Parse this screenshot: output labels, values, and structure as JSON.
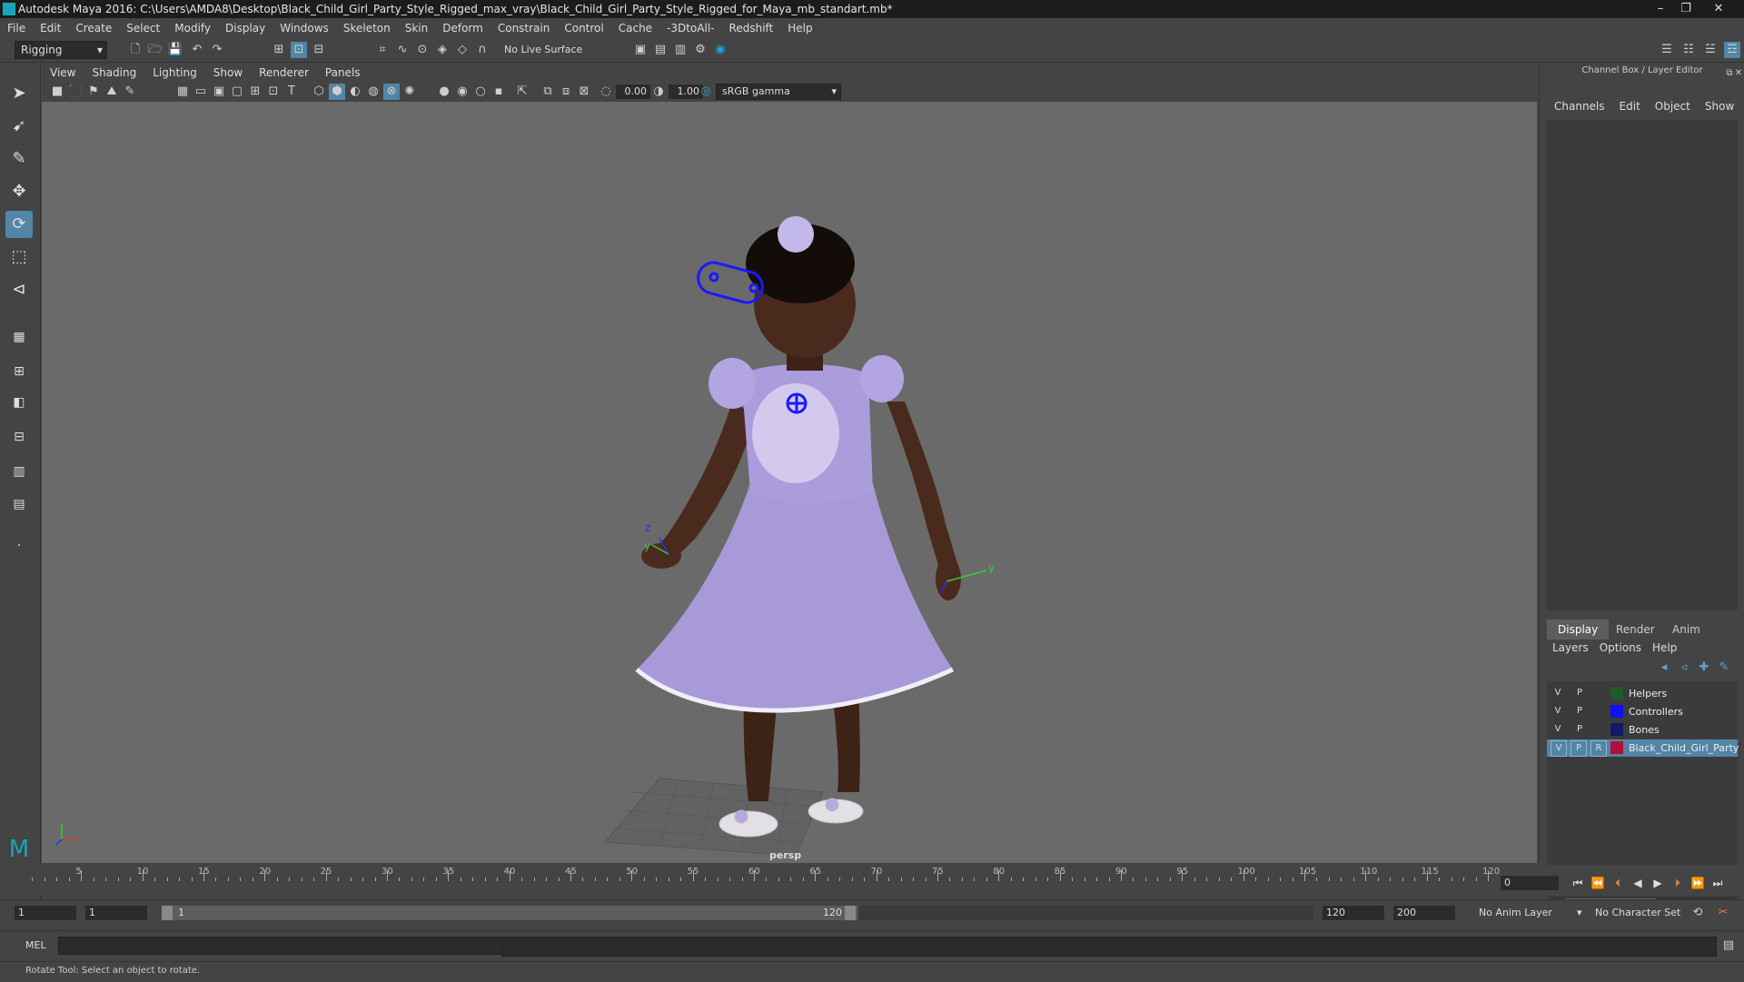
{
  "window": {
    "title": "Autodesk Maya 2016: C:\\Users\\AMDA8\\Desktop\\Black_Child_Girl_Party_Style_Rigged_max_vray\\Black_Child_Girl_Party_Style_Rigged_for_Maya_mb_standart.mb*"
  },
  "menubar": {
    "items": [
      "File",
      "Edit",
      "Create",
      "Select",
      "Modify",
      "Display",
      "Windows",
      "Skeleton",
      "Skin",
      "Deform",
      "Constrain",
      "Control",
      "Cache",
      "-3DtoAll-",
      "Redshift",
      "Help"
    ]
  },
  "statusline": {
    "mode": "Rigging",
    "live_surface": "No Live Surface"
  },
  "panel": {
    "menu": [
      "View",
      "Shading",
      "Lighting",
      "Show",
      "Renderer",
      "Panels"
    ],
    "near_value": "0.00",
    "far_value": "1.00",
    "color_space": "sRGB gamma",
    "camera_label": "persp"
  },
  "channelbox": {
    "title": "Channel Box / Layer Editor",
    "menu": [
      "Channels",
      "Edit",
      "Object",
      "Show"
    ]
  },
  "layer_editor": {
    "tabs": [
      "Display",
      "Render",
      "Anim"
    ],
    "active_tab": "Display",
    "menu": [
      "Layers",
      "Options",
      "Help"
    ],
    "layers": [
      {
        "v": "V",
        "p": "P",
        "r": "",
        "name": "Helpers",
        "color": "#1e5a2a",
        "selected": false
      },
      {
        "v": "V",
        "p": "P",
        "r": "",
        "name": "Controllers",
        "color": "#1010ff",
        "selected": false
      },
      {
        "v": "V",
        "p": "P",
        "r": "",
        "name": "Bones",
        "color": "#101a66",
        "selected": false
      },
      {
        "v": "V",
        "p": "P",
        "r": "R",
        "name": "Black_Child_Girl_Party",
        "color": "#b0103a",
        "selected": true
      }
    ]
  },
  "timeslider": {
    "ticks": [
      "5",
      "10",
      "15",
      "20",
      "25",
      "30",
      "35",
      "40",
      "45",
      "50",
      "55",
      "60",
      "65",
      "70",
      "75",
      "80",
      "85",
      "90",
      "95",
      "100",
      "105",
      "110",
      "115",
      "120"
    ],
    "current_frame": "0"
  },
  "range": {
    "start": "1",
    "anim_start": "1",
    "range_start": "1",
    "range_end": "120",
    "anim_end": "120",
    "end": "200",
    "anim_layer": "No Anim Layer",
    "char_set": "No Character Set"
  },
  "command": {
    "label": "MEL"
  },
  "help": {
    "text": "Rotate Tool: Select an object to rotate."
  },
  "colors": {
    "accent": "#5285a6",
    "dress": "#a89ad8",
    "skin": "#4a2a1c",
    "viewport_bg": "#6a6a6a"
  }
}
